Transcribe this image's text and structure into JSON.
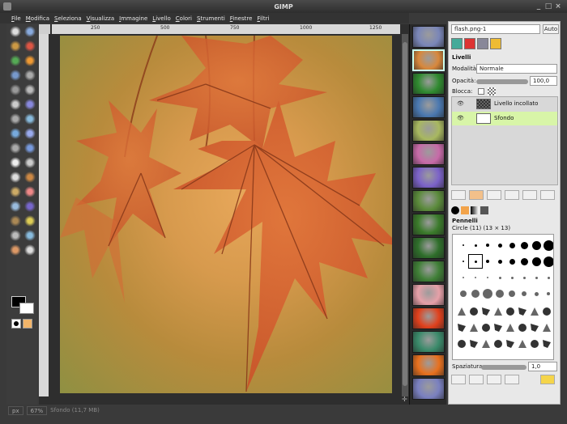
{
  "window": {
    "title": "GIMP"
  },
  "menu": [
    "File",
    "Modifica",
    "Seleziona",
    "Visualizza",
    "Immagine",
    "Livello",
    "Colori",
    "Strumenti",
    "Finestre",
    "Filtri"
  ],
  "ruler": {
    "marks": [
      "250",
      "500",
      "750",
      "1000",
      "1250"
    ]
  },
  "status": {
    "units": "px",
    "zoom": "67%",
    "info": "Sfondo (11,7 MB)"
  },
  "dock": {
    "image_select": "flash.png-1",
    "auto_label": "Auto",
    "layers_header": "Livelli",
    "mode_label": "Modalità:",
    "mode_value": "Normale",
    "opacity_label": "Opacità:",
    "opacity_value": "100,0",
    "lock_label": "Blocca:",
    "layers": [
      {
        "name": "Livello incollato"
      },
      {
        "name": "Sfondo"
      }
    ],
    "brushes_header": "Pennelli",
    "brush_name": "Circle (11) (13 × 13)",
    "spacing_label": "Spaziatura:",
    "spacing_value": "1,0"
  },
  "colors": {
    "fg": "#000000",
    "bg": "#ffffff",
    "selected_layer": "#d8f5a8",
    "title_bg": "#3a3a3a"
  },
  "icons": [
    "rect-select-icon",
    "ellipse-select-icon",
    "lasso-icon",
    "wand-icon",
    "color-select-icon",
    "scissors-icon",
    "path-icon",
    "color-picker-icon",
    "zoom-icon",
    "measure-icon",
    "move-icon",
    "align-icon",
    "crop-icon",
    "rotate-icon",
    "scale-icon",
    "shear-icon",
    "perspective-icon",
    "flip-icon",
    "text-icon",
    "bucket-icon",
    "gradient-icon",
    "pencil-icon",
    "brush-icon",
    "eraser-icon",
    "airbrush-icon",
    "ink-icon",
    "clone-icon",
    "heal-icon",
    "perspective-clone-icon",
    "blur-icon",
    "smudge-icon",
    "dodge-icon"
  ]
}
